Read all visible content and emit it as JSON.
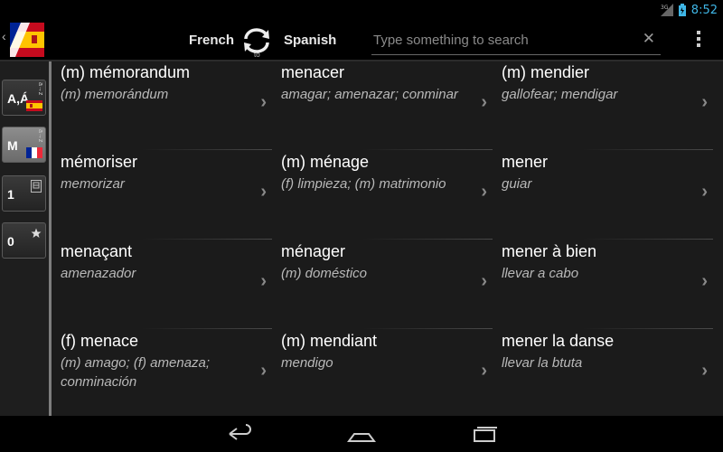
{
  "status": {
    "time": "8:52",
    "network": "3G"
  },
  "header": {
    "back_glyph": "‹",
    "logo_icon": "spain-flag-logo",
    "from_language": "French",
    "to_label": "to",
    "to_language": "Spanish",
    "search_placeholder": "Type something to search",
    "clear_glyph": "✕"
  },
  "sidebar": [
    {
      "label": "A,Á",
      "flag": "es",
      "sort": "a→z"
    },
    {
      "label": "M",
      "flag": "fr",
      "sort": "a→z"
    },
    {
      "label": "1",
      "icon": "history-icon"
    },
    {
      "label": "0",
      "icon": "star-icon"
    }
  ],
  "entries": [
    {
      "term": "(m) mémorandum",
      "translation": "(m) memorándum"
    },
    {
      "term": "menacer",
      "translation": "amagar; amenazar; conminar"
    },
    {
      "term": "(m) mendier",
      "translation": "gallofear; mendigar"
    },
    {
      "term": "mémoriser",
      "translation": "memorizar"
    },
    {
      "term": "(m) ménage",
      "translation": "(f) limpieza; (m) matrimonio"
    },
    {
      "term": "mener",
      "translation": "guiar"
    },
    {
      "term": "menaçant",
      "translation": "amenazador"
    },
    {
      "term": "ménager",
      "translation": "(m) doméstico"
    },
    {
      "term": "mener à bien",
      "translation": "llevar a cabo"
    },
    {
      "term": "(f) menace",
      "translation": "(m) amago; (f) amenaza; conminación"
    },
    {
      "term": "(m) mendiant",
      "translation": "mendigo"
    },
    {
      "term": "mener la danse",
      "translation": "llevar la btuta"
    }
  ],
  "chevron_glyph": "›",
  "navbar": {
    "back": "back-icon",
    "home": "home-icon",
    "recents": "recents-icon"
  }
}
